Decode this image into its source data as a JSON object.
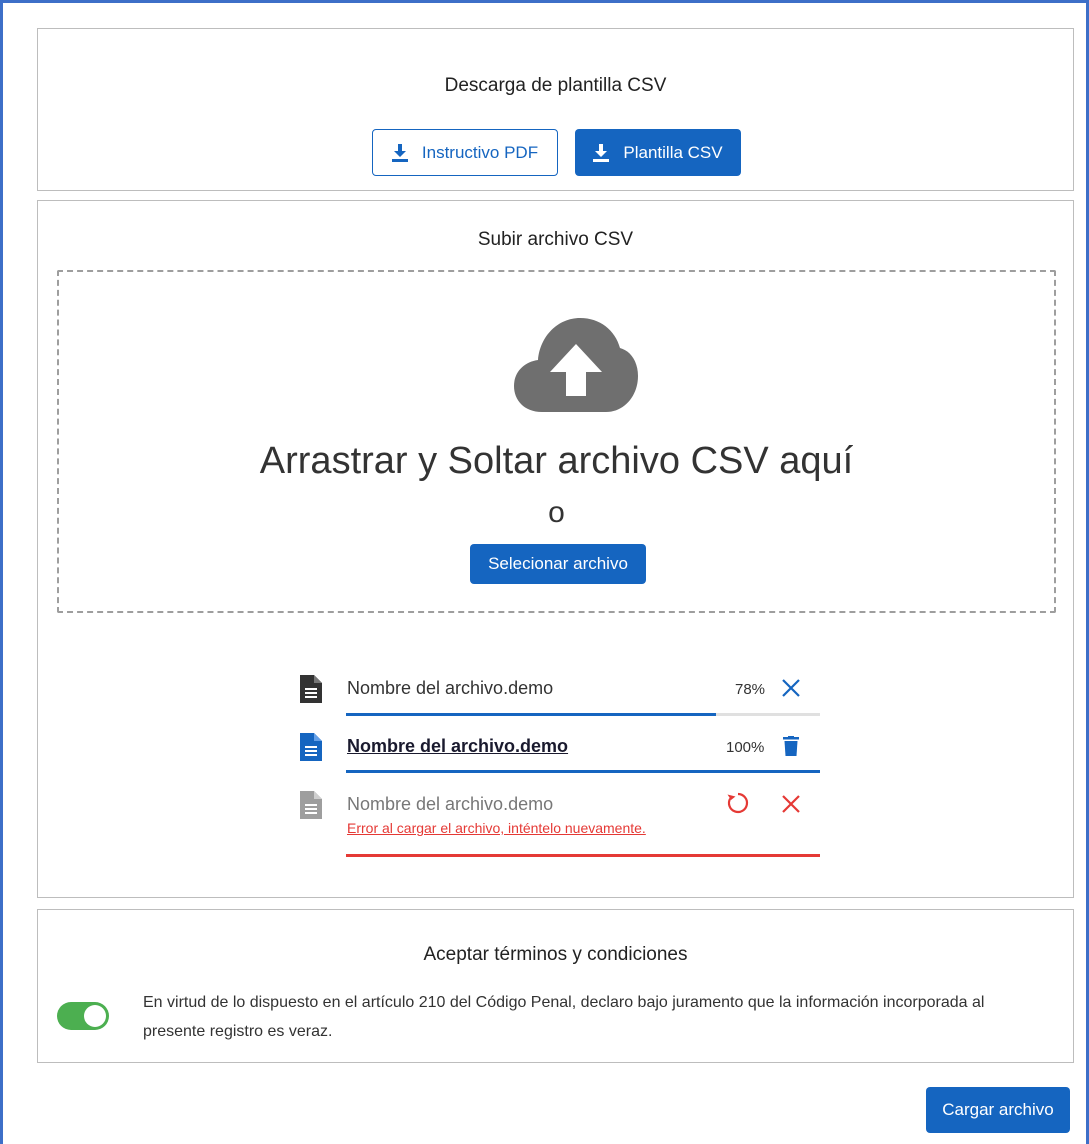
{
  "download": {
    "title": "Descarga de plantilla CSV",
    "pdf_button": "Instructivo PDF",
    "csv_button": "Plantilla CSV"
  },
  "upload": {
    "title": "Subir archivo CSV",
    "drop_text": "Arrastrar y Soltar archivo CSV aquí",
    "or_text": "o",
    "select_button": "Selecionar archivo",
    "files": [
      {
        "name": "Nombre del archivo.demo",
        "percent": "78%",
        "progress": 0.78,
        "state": "uploading"
      },
      {
        "name": "Nombre del archivo.demo",
        "percent": "100%",
        "progress": 1.0,
        "state": "complete"
      },
      {
        "name": "Nombre del archivo.demo",
        "state": "error",
        "error": "Error al cargar el archivo, inténtelo nuevamente."
      }
    ]
  },
  "terms": {
    "title": "Aceptar términos y condiciones",
    "text": "En virtud de lo dispuesto en el artículo 210 del Código Penal, declaro bajo juramento que la información incorporada al presente registro es veraz.",
    "accepted": true
  },
  "submit_button": "Cargar archivo",
  "colors": {
    "primary": "#1565c0",
    "error": "#e53935",
    "toggle_on": "#4caf50",
    "frame": "#3d6fc8"
  }
}
